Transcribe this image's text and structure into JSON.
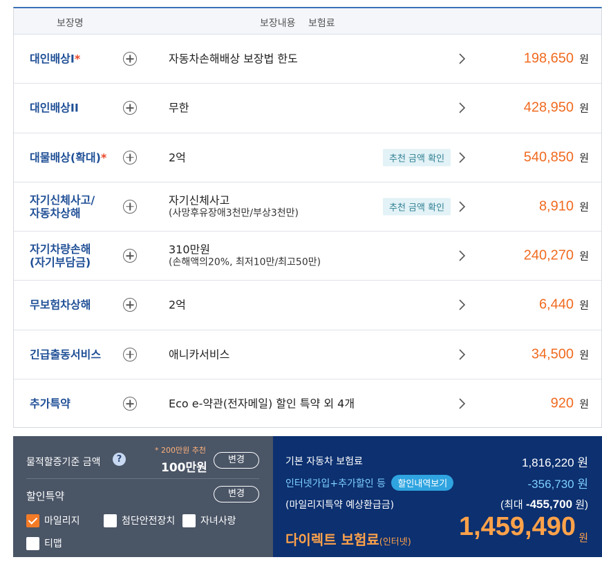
{
  "table": {
    "header": {
      "name": "보장명",
      "content": "보장내용",
      "premium": "보험료"
    },
    "rows": [
      {
        "name": "대인배상I",
        "star": "*",
        "content": "자동차손해배상 보장법 한도",
        "sub": "",
        "recommend": "",
        "amount": "198,650",
        "unit": "원"
      },
      {
        "name": "대인배상II",
        "star": "",
        "content": "무한",
        "sub": "",
        "recommend": "",
        "amount": "428,950",
        "unit": "원"
      },
      {
        "name": "대물배상(확대)",
        "star": "*",
        "content": "2억",
        "sub": "",
        "recommend": "추천 금액 확인",
        "amount": "540,850",
        "unit": "원"
      },
      {
        "name": "자기신체사고/\n자동차상해",
        "star": "",
        "content": "자기신체사고",
        "sub": "(사망후유장애3천만/부상3천만)",
        "recommend": "추천 금액 확인",
        "amount": "8,910",
        "unit": "원"
      },
      {
        "name": "자기차량손해\n(자기부담금)",
        "star": "",
        "content": "310만원",
        "sub": "(손해액의20%, 최저10만/최고50만)",
        "recommend": "",
        "amount": "240,270",
        "unit": "원"
      },
      {
        "name": "무보험차상해",
        "star": "",
        "content": "2억",
        "sub": "",
        "recommend": "",
        "amount": "6,440",
        "unit": "원"
      },
      {
        "name": "긴급출동서비스",
        "star": "",
        "content": "애니카서비스",
        "sub": "",
        "recommend": "",
        "amount": "34,500",
        "unit": "원"
      },
      {
        "name": "추가특약",
        "star": "",
        "content": "Eco e-약관(전자메일) 할인 특약 외 4개",
        "sub": "",
        "recommend": "",
        "amount": "920",
        "unit": "원"
      }
    ]
  },
  "summary_left": {
    "mileage_label": "물적할증기준 금액",
    "help_icon": "?",
    "note": "* 200만원 추천",
    "mileage_value": "100만원",
    "change_label": "변경",
    "discount_label": "할인특약",
    "discount_change_label": "변경",
    "options": [
      {
        "label": "마일리지",
        "checked": true
      },
      {
        "label": "첨단안전장치",
        "checked": false
      },
      {
        "label": "자녀사랑",
        "checked": false
      },
      {
        "label": "티맵",
        "checked": false
      }
    ]
  },
  "summary_right": {
    "base_label": "기본 자동차 보험료",
    "base_value": "1,816,220 원",
    "discount_label": "인터넷가입+추가할인 등",
    "discount_button": "할인내역보기",
    "discount_value": "-356,730 원",
    "refund_label": "(마일리지특약 예상환급금)",
    "refund_prefix": "(최대 ",
    "refund_value": "-455,700",
    "refund_suffix": " 원)",
    "total_label": "다이렉트 보험료",
    "total_sub": "(인터넷)",
    "total_value": "1,459,490",
    "total_unit": "원"
  },
  "colors": {
    "accent_orange": "#f06a1f",
    "name_blue": "#1f4f96",
    "panel_gray": "#4a5566",
    "panel_navy": "#0c3070"
  }
}
